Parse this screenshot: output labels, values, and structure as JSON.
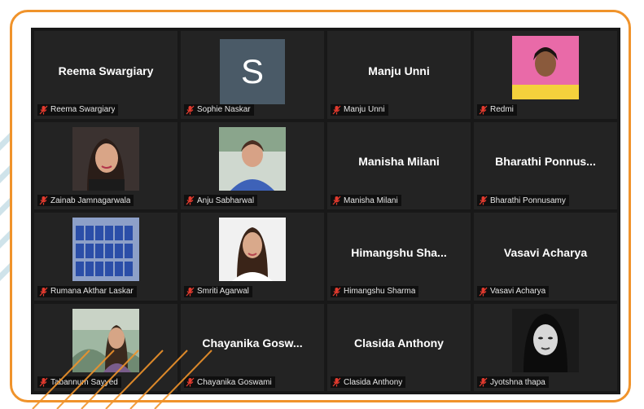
{
  "colors": {
    "frame_accent": "#f0932b",
    "screen_bg": "#181818",
    "tile_bg": "#232323",
    "mic_muted": "#e23a2e"
  },
  "participants": [
    {
      "display": "Reema Swargiary",
      "label": "Reema Swargiary",
      "mic": "mic-muted-icon"
    },
    {
      "display": "S",
      "label": "Sophie Naskar",
      "mic": "mic-muted-icon"
    },
    {
      "display": "Manju Unni",
      "label": "Manju Unni",
      "mic": "mic-muted-icon"
    },
    {
      "display": "",
      "label": "Redmi",
      "mic": "mic-muted-icon"
    },
    {
      "display": "",
      "label": "Zainab Jamnagarwala",
      "mic": "mic-muted-icon"
    },
    {
      "display": "",
      "label": "Anju Sabharwal",
      "mic": "mic-muted-icon"
    },
    {
      "display": "Manisha Milani",
      "label": "Manisha Milani",
      "mic": "mic-muted-icon"
    },
    {
      "display": "Bharathi Ponnus...",
      "label": "Bharathi Ponnusamy",
      "mic": "mic-muted-icon"
    },
    {
      "display": "",
      "label": "Rumana Akthar Laskar",
      "mic": "mic-muted-icon"
    },
    {
      "display": "",
      "label": "Smriti Agarwal",
      "mic": "mic-muted-icon"
    },
    {
      "display": "Himangshu Sha...",
      "label": "Himangshu Sharma",
      "mic": "mic-muted-icon"
    },
    {
      "display": "Vasavi Acharya",
      "label": "Vasavi Acharya",
      "mic": "mic-muted-icon"
    },
    {
      "display": "",
      "label": "Tabannum Sayyed",
      "mic": "mic-muted-icon"
    },
    {
      "display": "Chayanika Gosw...",
      "label": "Chayanika Goswami",
      "mic": "mic-muted-icon"
    },
    {
      "display": "Clasida Anthony",
      "label": "Clasida Anthony",
      "mic": "mic-muted-icon"
    },
    {
      "display": "",
      "label": "Jyotshna thapa",
      "mic": "mic-muted-icon"
    }
  ]
}
